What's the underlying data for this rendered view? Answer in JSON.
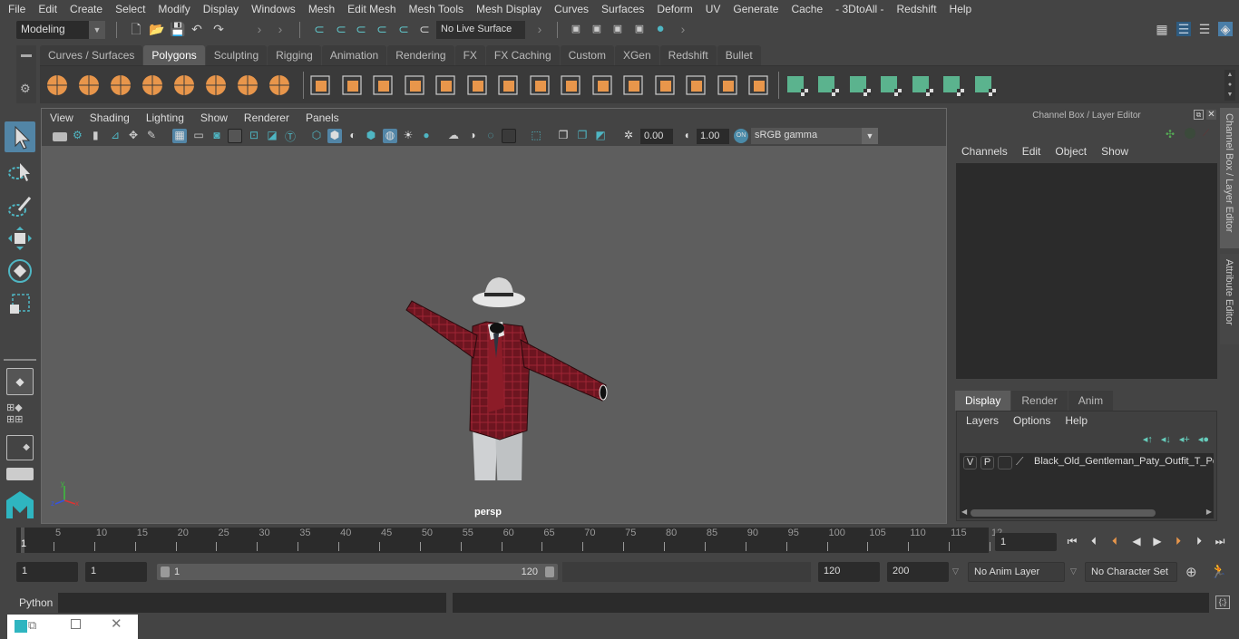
{
  "menubar": [
    "File",
    "Edit",
    "Create",
    "Select",
    "Modify",
    "Display",
    "Windows",
    "Mesh",
    "Edit Mesh",
    "Mesh Tools",
    "Mesh Display",
    "Curves",
    "Surfaces",
    "Deform",
    "UV",
    "Generate",
    "Cache",
    "- 3DtoAll -",
    "Redshift",
    "Help"
  ],
  "statusline": {
    "mode": "Modeling",
    "live_surface": "No Live Surface"
  },
  "shelf": {
    "tabs": [
      "Curves / Surfaces",
      "Polygons",
      "Sculpting",
      "Rigging",
      "Animation",
      "Rendering",
      "FX",
      "FX Caching",
      "Custom",
      "XGen",
      "Redshift",
      "Bullet"
    ],
    "active_tab": "Polygons",
    "icons_primitives": [
      "sphere-icon",
      "cube-icon",
      "cylinder-icon",
      "cone-icon",
      "plane-icon",
      "torus-icon",
      "pyramid-icon",
      "pipe-icon"
    ],
    "icons_ops": [
      "combine-icon",
      "separate-icon",
      "mirror-icon",
      "smooth-icon",
      "cube-outline-icon",
      "extract-icon",
      "multicut-icon",
      "extrude-icon",
      "bridge-icon",
      "bevel-icon",
      "insert-edge-loop-icon",
      "offset-edge-loop-icon",
      "merge-icon",
      "poke-icon",
      "fill-hole-icon"
    ],
    "icons_uv": [
      "planar-uv-icon",
      "cylindrical-uv-icon",
      "spherical-uv-icon",
      "automatic-uv-icon",
      "contour-stretch-uv-icon",
      "uv-editor-icon",
      "unfold-uv-icon"
    ],
    "accent_orange": "#e8964b",
    "accent_green": "#5bb38e"
  },
  "viewport": {
    "menu": [
      "View",
      "Shading",
      "Lighting",
      "Show",
      "Renderer",
      "Panels"
    ],
    "exposure": "0.00",
    "gamma": "1.00",
    "color_space": "sRGB gamma",
    "camera_label": "persp",
    "axis": {
      "x": "x",
      "y": "y",
      "z": "z"
    },
    "model_layer_colors": {
      "jacket": "#7a1a22",
      "pants": "#cfd1d3",
      "hat": "#e0e0e0"
    }
  },
  "channel_box": {
    "title": "Channel Box / Layer Editor",
    "menu": [
      "Channels",
      "Edit",
      "Object",
      "Show"
    ],
    "side_tabs": [
      "Channel Box / Layer Editor",
      "Attribute Editor"
    ]
  },
  "layer_editor": {
    "tabs": [
      "Display",
      "Render",
      "Anim"
    ],
    "active_tab": "Display",
    "menu": [
      "Layers",
      "Options",
      "Help"
    ],
    "layers": [
      {
        "v": "V",
        "p": "P",
        "name": "Black_Old_Gentleman_Paty_Outfit_T_Po"
      }
    ]
  },
  "timeline": {
    "ticks": [
      5,
      10,
      15,
      20,
      25,
      30,
      35,
      40,
      45,
      50,
      55,
      60,
      65,
      70,
      75,
      80,
      85,
      90,
      95,
      100,
      105,
      110,
      115,
      "12"
    ],
    "current_frame_marker": "1",
    "current_frame": "1"
  },
  "range": {
    "start_field": "1",
    "playback_start": "1",
    "range_start_label": "1",
    "range_end_label": "120",
    "playback_end": "120",
    "anim_end": "200",
    "anim_layer": "No Anim Layer",
    "character_set": "No Character Set"
  },
  "cmdline": {
    "label": "Python"
  }
}
